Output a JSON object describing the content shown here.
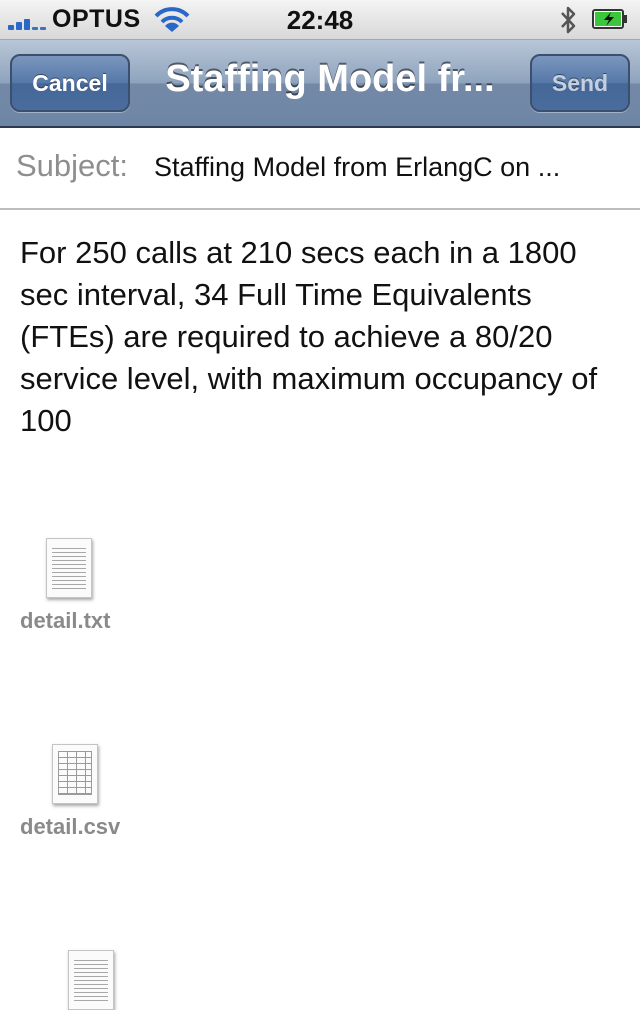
{
  "status_bar": {
    "carrier": "OPTUS",
    "time": "22:48",
    "icons": [
      "signal-bars-icon",
      "wifi-icon",
      "bluetooth-icon",
      "battery-charging-icon"
    ],
    "accent_color": "#2a68c8",
    "battery_color": "#3cc63c"
  },
  "nav": {
    "cancel_label": "Cancel",
    "title": "Staffing Model fr...",
    "send_label": "Send",
    "bar_color": "#6e86a6"
  },
  "compose": {
    "subject_label": "Subject:",
    "subject_value": "Staffing Model from ErlangC on ...",
    "body": "For 250 calls at 210 secs each in a 1800 sec interval, 34 Full Time Equivalents (FTEs) are required to achieve a 80/20 service level, with maximum occupancy of 100"
  },
  "attachments": [
    {
      "name": "detail.txt",
      "icon": "text-document-icon"
    },
    {
      "name": "detail.csv",
      "icon": "spreadsheet-document-icon"
    },
    {
      "name": "",
      "icon": "text-document-icon"
    }
  ]
}
